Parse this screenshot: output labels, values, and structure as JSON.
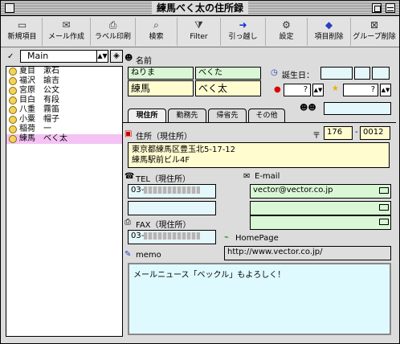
{
  "window": {
    "title": "練馬べく太の住所録"
  },
  "toolbar": {
    "new_label": "新規項目",
    "mail_label": "メール作成",
    "label_print_label": "ラベル印刷",
    "search_label": "検索",
    "filter_label": "Filter",
    "move_label": "引っ越し",
    "settings_label": "設定",
    "delete_label": "項目削除",
    "group_delete_label": "グループ削除"
  },
  "group": {
    "selected": "Main"
  },
  "contacts": [
    {
      "last": "夏目",
      "first": "漱石"
    },
    {
      "last": "福沢",
      "first": "諭吉"
    },
    {
      "last": "宮原",
      "first": "公文"
    },
    {
      "last": "目白",
      "first": "有段"
    },
    {
      "last": "八重",
      "first": "霧笛"
    },
    {
      "last": "小粟",
      "first": "帽子"
    },
    {
      "last": "稲荷",
      "first": "一"
    },
    {
      "last": "練馬",
      "first": "べく太"
    }
  ],
  "detail": {
    "name_label": "名前",
    "kana_last": "ねりま",
    "kana_first": "べくた",
    "name_last": "練馬",
    "name_first": "べく太",
    "birthday_label": "誕生日：",
    "rank1": "?",
    "rank2": "?",
    "tabs": [
      "現住所",
      "勤務先",
      "帰省先",
      "その他"
    ],
    "address_label": "住所（現住所）",
    "postal_mark": "〒",
    "postal1": "176",
    "postal2": "0012",
    "address_line1": "東京都練馬区豊玉北5-17-12",
    "address_line2": "練馬駅前ビル4F",
    "tel_label": "TEL（現住所）",
    "tel": "03-",
    "email_label": "E-mail",
    "email1": "vector@vector.co.jp",
    "fax_label": "FAX（現住所）",
    "fax": "03-",
    "homepage_label": "HomePage",
    "homepage": "http://www.vector.co.jp/",
    "memo_label": "memo",
    "memo": "メールニュース「ベックル」もよろしく！"
  }
}
